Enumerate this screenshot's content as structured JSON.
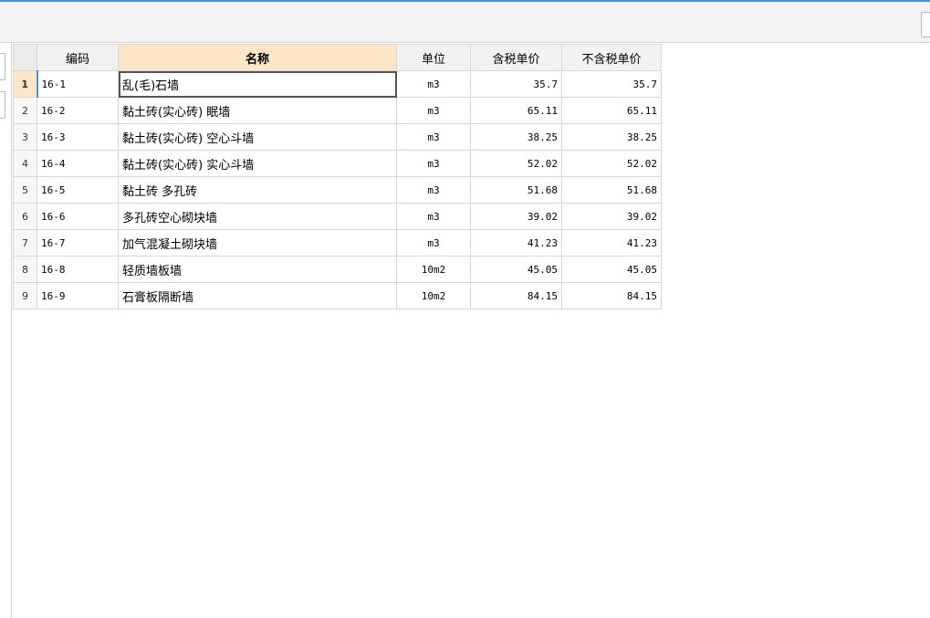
{
  "grid": {
    "columns": {
      "code": "编码",
      "name": "名称",
      "unit": "单位",
      "price_tax": "含税单价",
      "price_notax": "不含税单价"
    },
    "rows": [
      {
        "no": "1",
        "code": "16-1",
        "name": "乱(毛)石墙",
        "unit": "m3",
        "price_tax": "35.7",
        "price_notax": "35.7"
      },
      {
        "no": "2",
        "code": "16-2",
        "name": "黏土砖(实心砖) 眠墙",
        "unit": "m3",
        "price_tax": "65.11",
        "price_notax": "65.11"
      },
      {
        "no": "3",
        "code": "16-3",
        "name": "黏土砖(实心砖) 空心斗墙",
        "unit": "m3",
        "price_tax": "38.25",
        "price_notax": "38.25"
      },
      {
        "no": "4",
        "code": "16-4",
        "name": "黏土砖(实心砖) 实心斗墙",
        "unit": "m3",
        "price_tax": "52.02",
        "price_notax": "52.02"
      },
      {
        "no": "5",
        "code": "16-5",
        "name": "黏土砖 多孔砖",
        "unit": "m3",
        "price_tax": "51.68",
        "price_notax": "51.68"
      },
      {
        "no": "6",
        "code": "16-6",
        "name": "多孔砖空心砌块墙",
        "unit": "m3",
        "price_tax": "39.02",
        "price_notax": "39.02"
      },
      {
        "no": "7",
        "code": "16-7",
        "name": "加气混凝土砌块墙",
        "unit": "m3",
        "price_tax": "41.23",
        "price_notax": "41.23"
      },
      {
        "no": "8",
        "code": "16-8",
        "name": "轻质墙板墙",
        "unit": "10m2",
        "price_tax": "45.05",
        "price_notax": "45.05"
      },
      {
        "no": "9",
        "code": "16-9",
        "name": "石膏板隔断墙",
        "unit": "10m2",
        "price_tax": "84.15",
        "price_notax": "84.15"
      }
    ]
  }
}
